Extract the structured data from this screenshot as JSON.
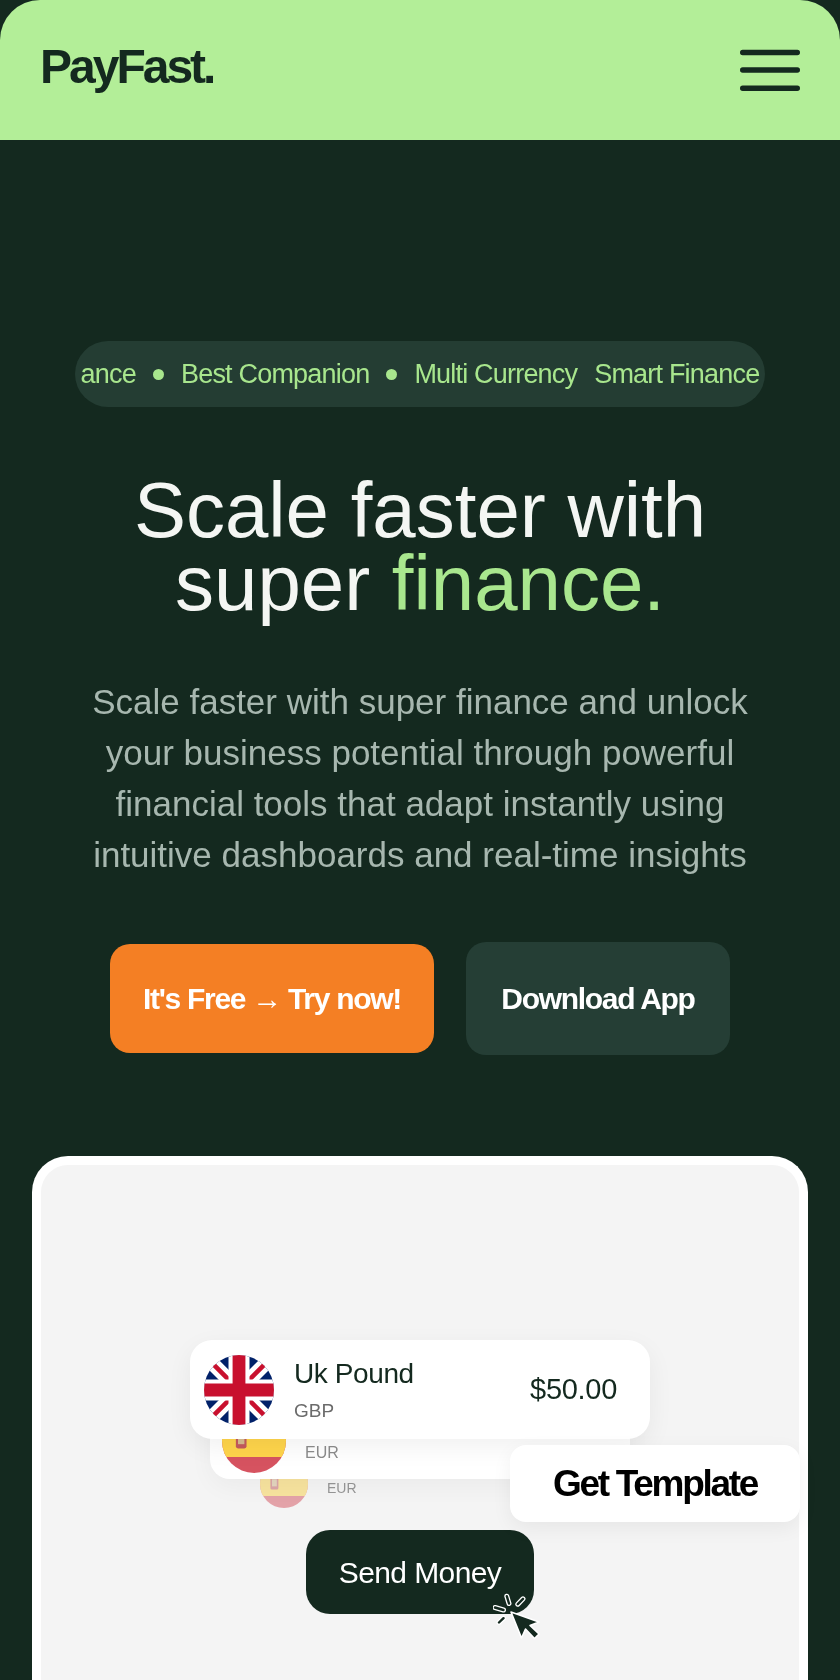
{
  "header": {
    "logo": "PayFast."
  },
  "ticker": {
    "items": [
      {
        "kind": "text",
        "text": "ance"
      },
      {
        "kind": "dot"
      },
      {
        "kind": "text",
        "text": "Best Companion"
      },
      {
        "kind": "dot"
      },
      {
        "kind": "text",
        "text": "Multi Currency"
      },
      {
        "kind": "text",
        "text": "Smart Finance"
      }
    ]
  },
  "hero": {
    "title": {
      "text": "Scale faster with super",
      "accent": "finance."
    },
    "description": "Scale faster with super finance and unlock your business potential through powerful financial tools that adapt instantly using intuitive dashboards and real-time insights",
    "buttons": [
      {
        "kind": "primary",
        "label": "It's Free → Try now!"
      },
      {
        "kind": "secondary",
        "label": "Download App"
      }
    ]
  },
  "preview": {
    "currencies": [
      {
        "kind": "uk",
        "name": "Uk Pound",
        "code": "GBP",
        "amount": "$50.00"
      },
      {
        "kind": "spain",
        "code": "EUR"
      },
      {
        "kind": "spain",
        "code": "EUR"
      }
    ],
    "template_button": "Get Template",
    "send_button": "Send Money"
  }
}
